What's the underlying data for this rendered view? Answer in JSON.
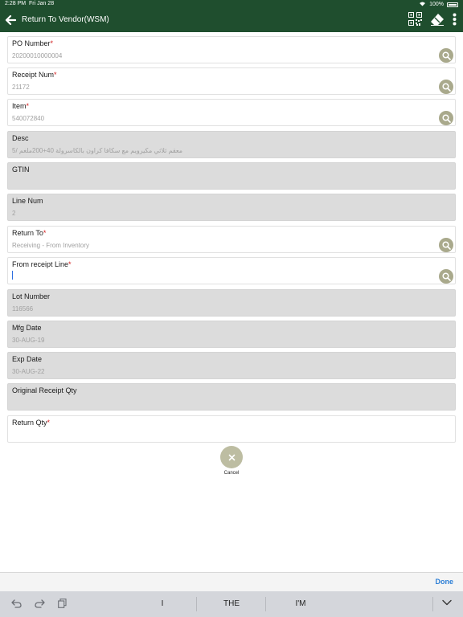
{
  "status_bar": {
    "time": "2:28 PM",
    "date": "Fri Jan 28",
    "battery": "100%"
  },
  "header": {
    "title": "Return To Vendor(WSM)",
    "icons": [
      "back-arrow-icon",
      "qr-code-icon",
      "eraser-icon",
      "more-vertical-icon"
    ]
  },
  "fields": {
    "po_number": {
      "label": "PO Number",
      "required": "*",
      "value": "20200010000004"
    },
    "receipt_num": {
      "label": "Receipt Num",
      "required": "*",
      "value": "21172"
    },
    "item": {
      "label": "Item",
      "required": "*",
      "value": "540072840"
    },
    "desc": {
      "label": "Desc",
      "value": "معقم ثلاثي مكيرويم مع سكافا كراون بالكاسرولة 40+200ملغم /5"
    },
    "gtin": {
      "label": "GTIN",
      "value": ""
    },
    "line_num": {
      "label": "Line Num",
      "value": "2"
    },
    "return_to": {
      "label": "Return To",
      "required": "*",
      "value": "Receiving - From Inventory"
    },
    "from_receipt_line": {
      "label": "From receipt Line",
      "required": "*",
      "value": ""
    },
    "lot_number": {
      "label": "Lot Number",
      "value": "116566"
    },
    "mfg_date": {
      "label": "Mfg Date",
      "value": "30-AUG-19"
    },
    "exp_date": {
      "label": "Exp Date",
      "value": "30-AUG-22"
    },
    "original_receipt_qty": {
      "label": "Original Receipt Qty",
      "value": ""
    },
    "return_qty": {
      "label": "Return Qty",
      "required": "*",
      "value": ""
    }
  },
  "actions": {
    "cancel_label": "Cancel"
  },
  "keyboard": {
    "done_label": "Done",
    "suggestions": [
      "I",
      "THE",
      "I'M"
    ]
  },
  "colors": {
    "header_bg": "#1f4e2e",
    "accent": "#a9a98c",
    "required": "#d42020",
    "done": "#2d7fd6"
  }
}
